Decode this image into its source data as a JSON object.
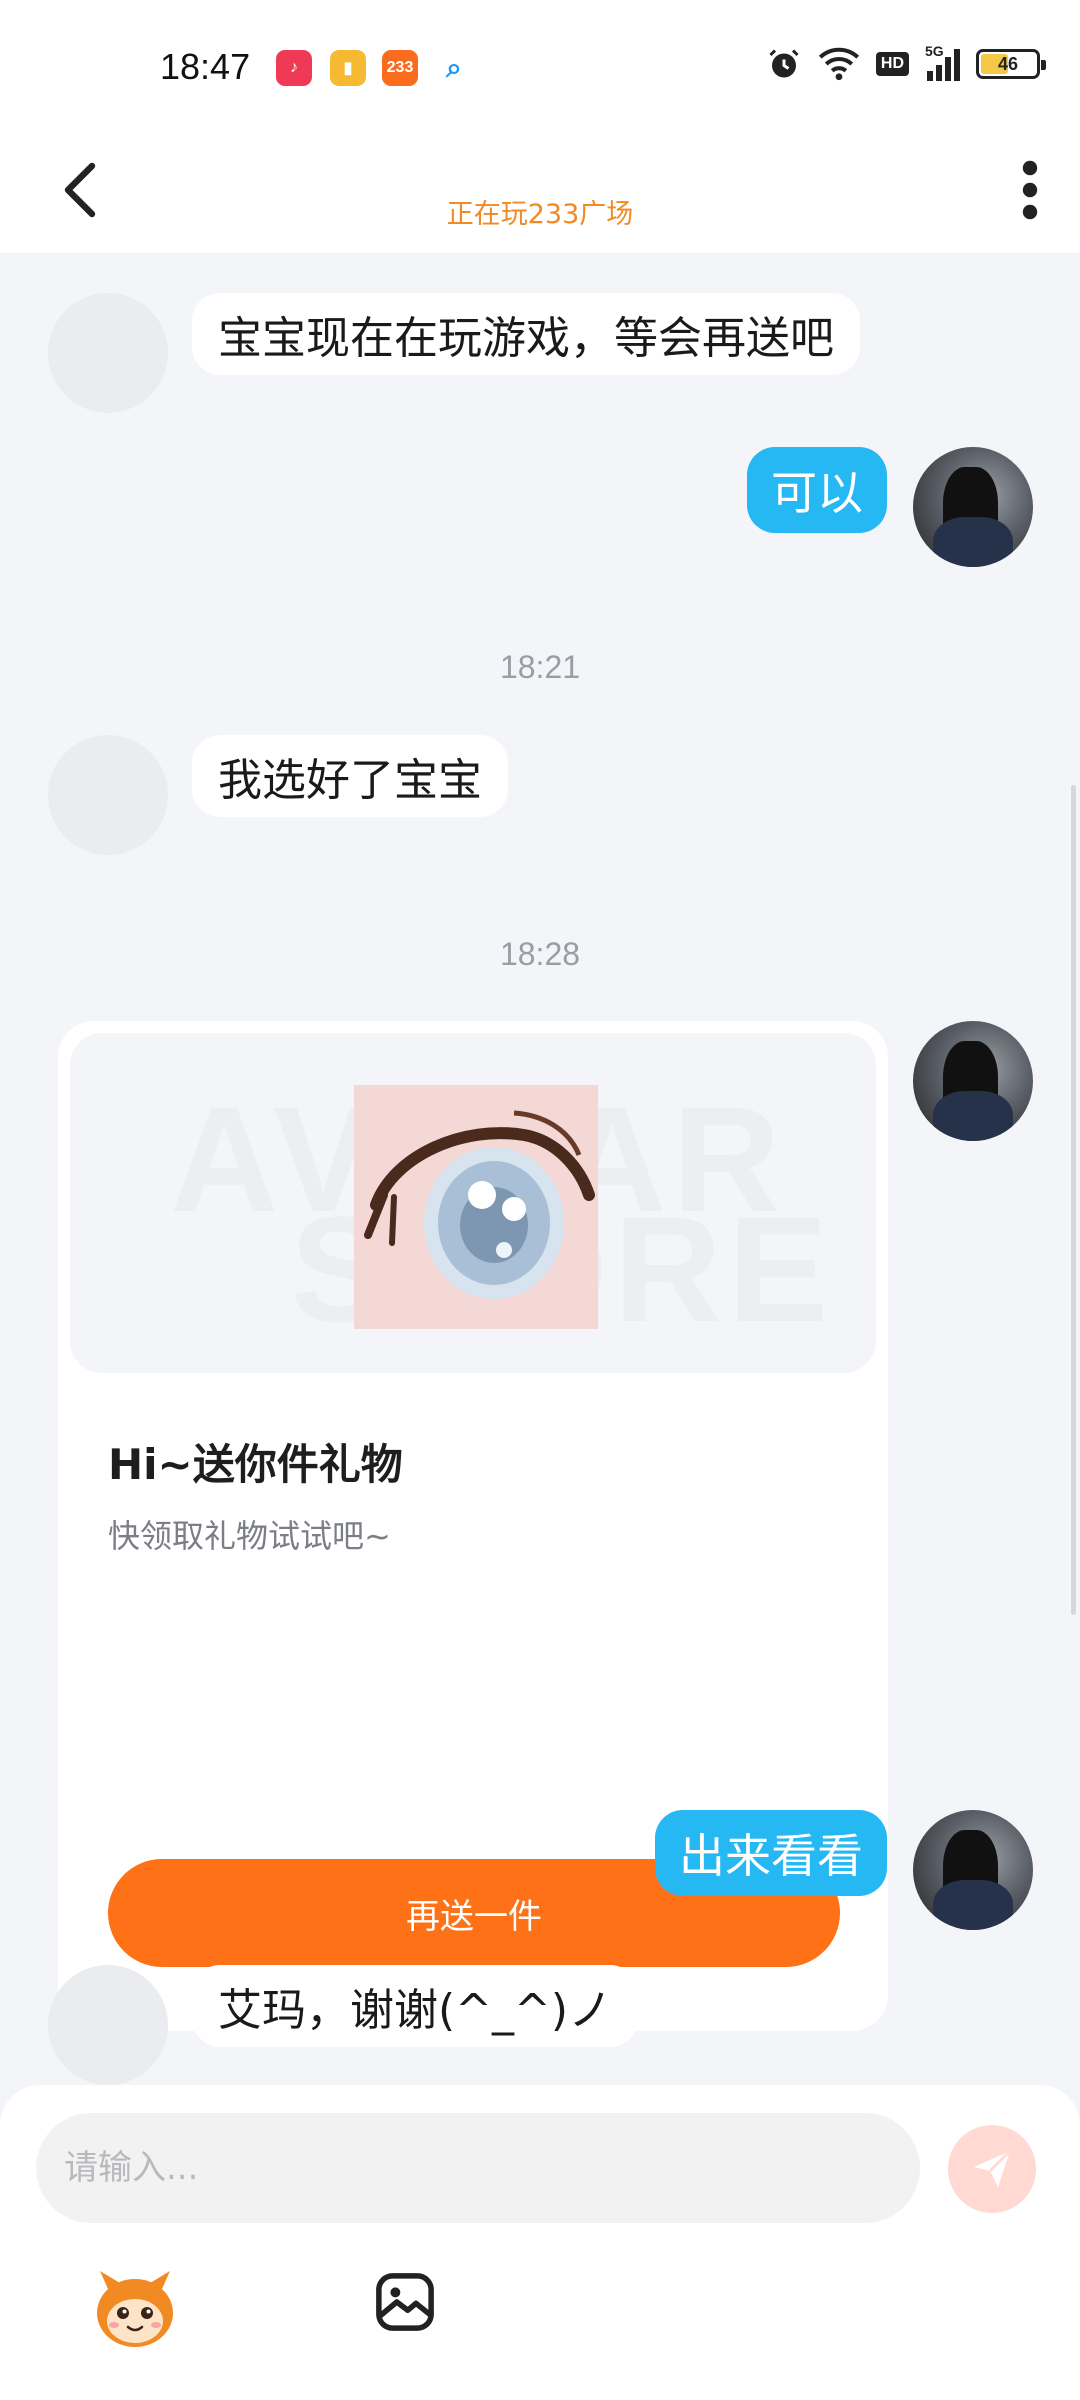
{
  "status_bar": {
    "time": "18:47",
    "apps": [
      {
        "name": "music-app",
        "color": "#f03a55",
        "glyph": "♪"
      },
      {
        "name": "books-app",
        "color": "#f5b932",
        "glyph": "▮"
      },
      {
        "name": "233-app",
        "color": "#fb6b1d",
        "glyph": "233"
      },
      {
        "name": "search-app",
        "color": "#2196f3",
        "glyph": "⌕"
      }
    ],
    "network": "5G",
    "hd_label": "HD",
    "battery": "46"
  },
  "header": {
    "subtitle": "正在玩233广场"
  },
  "messages": {
    "m1": "宝宝现在在玩游戏，等会再送吧",
    "m2": "可以",
    "ts1": "18:21",
    "m3": "我选好了宝宝",
    "ts2": "18:28",
    "m5": "出来看看",
    "m6": "艾玛，谢谢(^_^)ノ"
  },
  "gift_card": {
    "watermark_top": "AVATAR",
    "watermark_bottom": "STORE",
    "title": "Hi~送你件礼物",
    "description": "快领取礼物试试吧~",
    "button_label": "再送一件"
  },
  "input": {
    "placeholder": "请输入..."
  },
  "colors": {
    "accent_orange": "#fe7117",
    "bubble_blue": "#26b8f3",
    "subtitle_orange": "#f28a24"
  }
}
